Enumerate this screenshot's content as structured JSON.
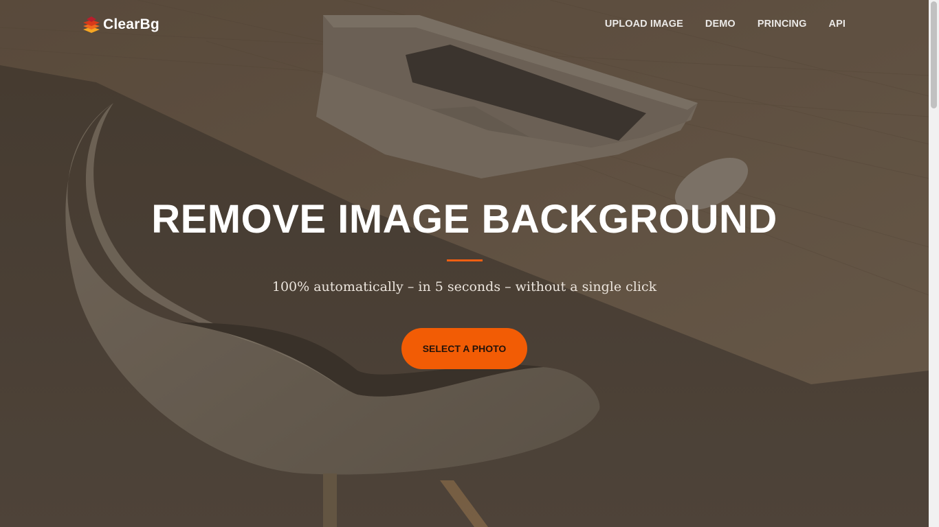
{
  "brand": {
    "name": "ClearBg",
    "icon": "layered-stack-logo-icon"
  },
  "nav": {
    "items": [
      {
        "label": "UPLOAD IMAGE"
      },
      {
        "label": "DEMO"
      },
      {
        "label": "PRINCING"
      },
      {
        "label": "API"
      }
    ]
  },
  "hero": {
    "title": "REMOVE IMAGE BACKGROUND",
    "subtitle": "100% automatically – in 5 seconds – without a single click",
    "cta_label": "SELECT A PHOTO",
    "background": "photo of laptop, mouse and chair on wooden desk"
  },
  "colors": {
    "accent": "#f25c05",
    "overlay": "#4a4036",
    "text": "#ffffff"
  }
}
